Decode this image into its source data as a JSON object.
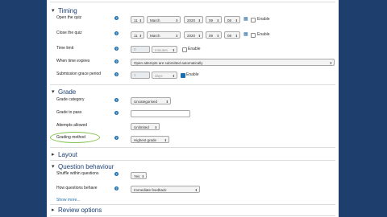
{
  "timing": {
    "title": "Timing",
    "open_label": "Open the quiz",
    "close_label": "Close the quiz",
    "open": {
      "day": "11",
      "month": "March",
      "year": "2020",
      "hour": "09",
      "minute": "08"
    },
    "close": {
      "day": "11",
      "month": "March",
      "year": "2020",
      "hour": "09",
      "minute": "08"
    },
    "enable_label": "Enable",
    "time_limit_label": "Time limit",
    "time_limit_value": "0",
    "time_limit_unit": "minutes",
    "expire_label": "When time expires",
    "expire_value": "Open attempts are submitted automatically",
    "grace_label": "Submission grace period",
    "grace_value": "1",
    "grace_unit": "days"
  },
  "grade": {
    "title": "Grade",
    "category_label": "Grade category",
    "category_value": "Uncategorised",
    "pass_label": "Grade to pass",
    "pass_value": "",
    "attempts_label": "Attempts allowed",
    "attempts_value": "Unlimited",
    "method_label": "Grading method",
    "method_value": "Highest grade"
  },
  "layout": {
    "title": "Layout"
  },
  "question_behaviour": {
    "title": "Question behaviour",
    "shuffle_label": "Shuffle within questions",
    "shuffle_value": "Yes",
    "behave_label": "How questions behave",
    "behave_value": "Immediate feedback",
    "show_more": "Show more..."
  },
  "review": {
    "title": "Review options"
  },
  "icons": {
    "help": "?",
    "calendar": "calendar-icon",
    "expanded": "chevron-down-icon",
    "collapsed": "chevron-right-icon",
    "select_arrow": "caret-icon"
  },
  "colors": {
    "page_bg": "#1e3f6e",
    "heading": "#1a3f73",
    "help": "#1a6fb0",
    "highlight": "#7fc24a"
  }
}
